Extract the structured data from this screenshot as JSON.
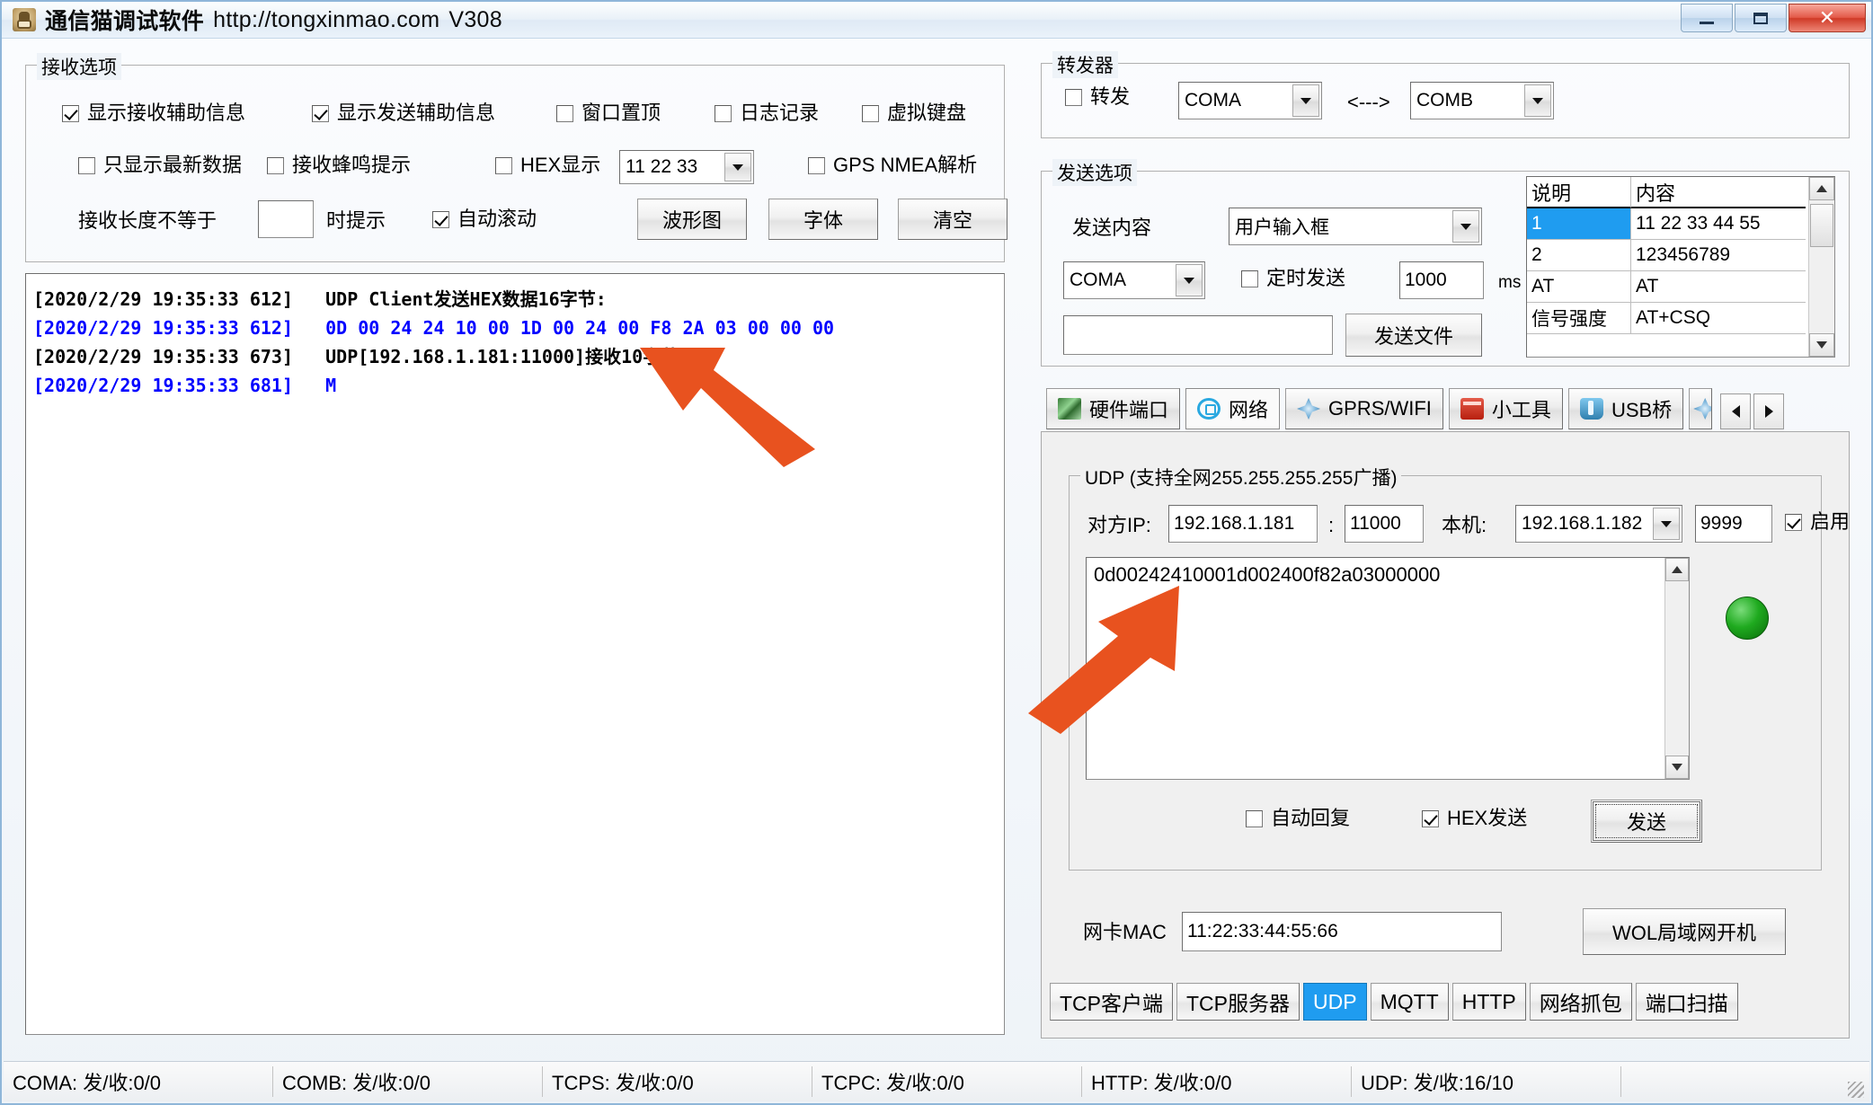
{
  "window": {
    "title": "通信猫调试软件",
    "url": "http://tongxinmao.com",
    "version": "V308",
    "icon": "cat-icon",
    "minimize_label": "",
    "maximize_label": "",
    "close_label": "✕"
  },
  "receive_options": {
    "group_title": "接收选项",
    "checks": [
      {
        "label": "显示接收辅助信息",
        "checked": true
      },
      {
        "label": "显示发送辅助信息",
        "checked": true
      },
      {
        "label": "窗口置顶",
        "checked": false
      },
      {
        "label": "日志记录",
        "checked": false
      },
      {
        "label": "虚拟键盘",
        "checked": false
      },
      {
        "label": "只显示最新数据",
        "checked": false
      },
      {
        "label": "接收蜂鸣提示",
        "checked": false
      },
      {
        "label": "HEX显示",
        "checked": false
      },
      {
        "label": "GPS NMEA解析",
        "checked": false
      },
      {
        "label": "自动滚动",
        "checked": true
      }
    ],
    "hex_format_value": "11 22 33",
    "length_prefix_label": "接收长度不等于",
    "length_value": "",
    "length_suffix_label": "时提示",
    "buttons": [
      "波形图",
      "字体",
      "清空"
    ]
  },
  "log": {
    "lines": [
      {
        "time": "[2020/2/29 19:35:33 612]",
        "text": "UDP Client发送HEX数据16字节:",
        "color": "black"
      },
      {
        "time": "[2020/2/29 19:35:33 612]",
        "text": "0D 00 24 24 10 00 1D 00 24 00 F8 2A 03 00 00 00",
        "color": "blue"
      },
      {
        "time": "[2020/2/29 19:35:33 673]",
        "text": "UDP[192.168.1.181:11000]接收10字节:",
        "color": "black"
      },
      {
        "time": "[2020/2/29 19:35:33 681]",
        "text": "M",
        "color": "blue"
      }
    ]
  },
  "forwarder": {
    "group_title": "转发器",
    "check_label": "转发",
    "checked": false,
    "source": "COMA",
    "link_label": "<--->",
    "target": "COMB"
  },
  "send_options": {
    "group_title": "发送选项",
    "content_label": "发送内容",
    "content_value": "用户输入框",
    "port_value": "COMA",
    "timer_label": "定时发送",
    "timer_checked": false,
    "timer_value": "1000",
    "timer_unit": "ms",
    "file_path": "",
    "send_file_label": "发送文件"
  },
  "quick_table": {
    "headers": [
      "说明",
      "内容"
    ],
    "rows": [
      {
        "name": "1",
        "content": "11 22 33 44 55",
        "selected": true
      },
      {
        "name": "2",
        "content": "123456789",
        "selected": false
      },
      {
        "name": "AT",
        "content": "AT",
        "selected": false
      },
      {
        "name": "信号强度",
        "content": "AT+CSQ",
        "selected": false
      }
    ]
  },
  "main_tabs": {
    "items": [
      {
        "label": "硬件端口",
        "icon": "hardware-port-icon",
        "active": false
      },
      {
        "label": "网络",
        "icon": "network-icon",
        "active": true
      },
      {
        "label": "GPRS/WIFI",
        "icon": "gprs-wifi-icon",
        "active": false
      },
      {
        "label": "小工具",
        "icon": "toolbox-icon",
        "active": false
      },
      {
        "label": "USB桥",
        "icon": "usb-bridge-icon",
        "active": false
      }
    ],
    "nav_prev": "◀",
    "nav_next": "▶"
  },
  "udp_panel": {
    "group_title": "UDP (支持全网255.255.255.255广播)",
    "remote_ip_label": "对方IP:",
    "remote_ip": "192.168.1.181",
    "colon": ":",
    "remote_port": "11000",
    "local_label": "本机:",
    "local_ip": "192.168.1.182",
    "local_port": "9999",
    "enable_label": "启用",
    "enable_checked": true,
    "data": "0d00242410001d002400f82a03000000",
    "auto_reply_label": "自动回复",
    "auto_reply_checked": false,
    "hex_send_label": "HEX发送",
    "hex_send_checked": true,
    "send_button": "发送",
    "led_state": "green"
  },
  "wol": {
    "mac_label": "网卡MAC",
    "mac_value": "11:22:33:44:55:66",
    "button_label": "WOL局域网开机"
  },
  "protocol_tabs": {
    "items": [
      {
        "label": "TCP客户端",
        "active": false
      },
      {
        "label": "TCP服务器",
        "active": false
      },
      {
        "label": "UDP",
        "active": true
      },
      {
        "label": "MQTT",
        "active": false
      },
      {
        "label": "HTTP",
        "active": false
      },
      {
        "label": "网络抓包",
        "active": false
      },
      {
        "label": "端口扫描",
        "active": false
      }
    ]
  },
  "status_bar": {
    "cells": [
      "COMA: 发/收:0/0",
      "COMB: 发/收:0/0",
      "TCPS: 发/收:0/0",
      "TCPC: 发/收:0/0",
      "HTTP: 发/收:0/0",
      "UDP: 发/收:16/10",
      ""
    ]
  },
  "annotations": {
    "arrow_color": "#E8521F",
    "arrow1": "points-to-receive-log-line",
    "arrow2": "points-to-udp-data-field"
  }
}
